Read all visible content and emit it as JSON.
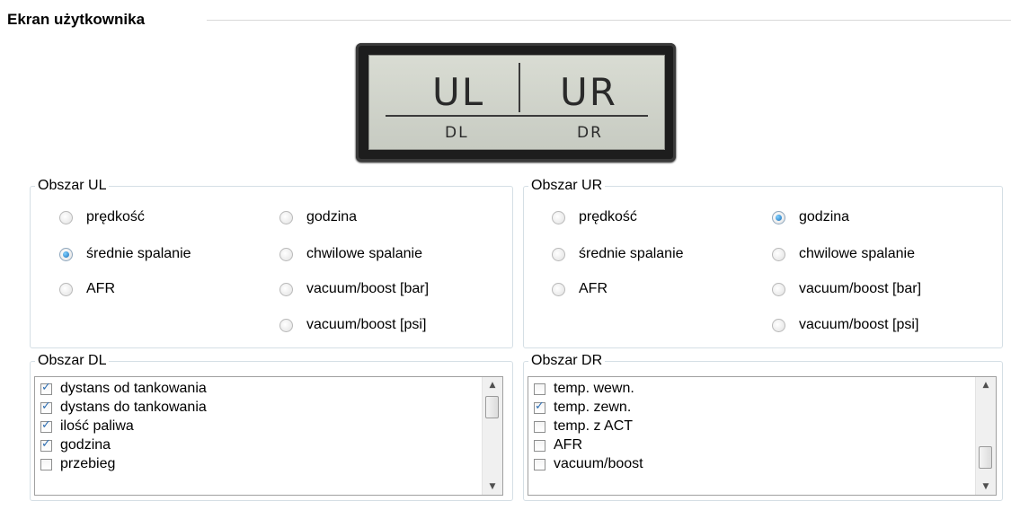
{
  "screen": {
    "title": "Ekran użytkownika",
    "lcd": {
      "ul": "UL",
      "ur": "UR",
      "dl": "DL",
      "dr": "DR"
    }
  },
  "areas": {
    "ul": {
      "title": "Obszar UL",
      "options": [
        {
          "label": "prędkość",
          "checked": false
        },
        {
          "label": "średnie spalanie",
          "checked": true
        },
        {
          "label": "AFR",
          "checked": false
        },
        {
          "label": "godzina",
          "checked": false
        },
        {
          "label": "chwilowe spalanie",
          "checked": false
        },
        {
          "label": "vacuum/boost [bar]",
          "checked": false
        },
        {
          "label": "vacuum/boost [psi]",
          "checked": false
        }
      ]
    },
    "ur": {
      "title": "Obszar UR",
      "options": [
        {
          "label": "prędkość",
          "checked": false
        },
        {
          "label": "średnie spalanie",
          "checked": false
        },
        {
          "label": "AFR",
          "checked": false
        },
        {
          "label": "godzina",
          "checked": true
        },
        {
          "label": "chwilowe spalanie",
          "checked": false
        },
        {
          "label": "vacuum/boost [bar]",
          "checked": false
        },
        {
          "label": "vacuum/boost [psi]",
          "checked": false
        }
      ]
    },
    "dl": {
      "title": "Obszar DL",
      "items": [
        {
          "label": "dystans od tankowania",
          "checked": true
        },
        {
          "label": "dystans do tankowania",
          "checked": true
        },
        {
          "label": "ilość paliwa",
          "checked": true
        },
        {
          "label": "godzina",
          "checked": true
        },
        {
          "label": "przebieg",
          "checked": false
        }
      ]
    },
    "dr": {
      "title": "Obszar DR",
      "items": [
        {
          "label": "temp. wewn.",
          "checked": false
        },
        {
          "label": "temp. zewn.",
          "checked": true
        },
        {
          "label": "temp. z ACT",
          "checked": false
        },
        {
          "label": "AFR",
          "checked": false
        },
        {
          "label": "vacuum/boost",
          "checked": false
        }
      ]
    }
  }
}
